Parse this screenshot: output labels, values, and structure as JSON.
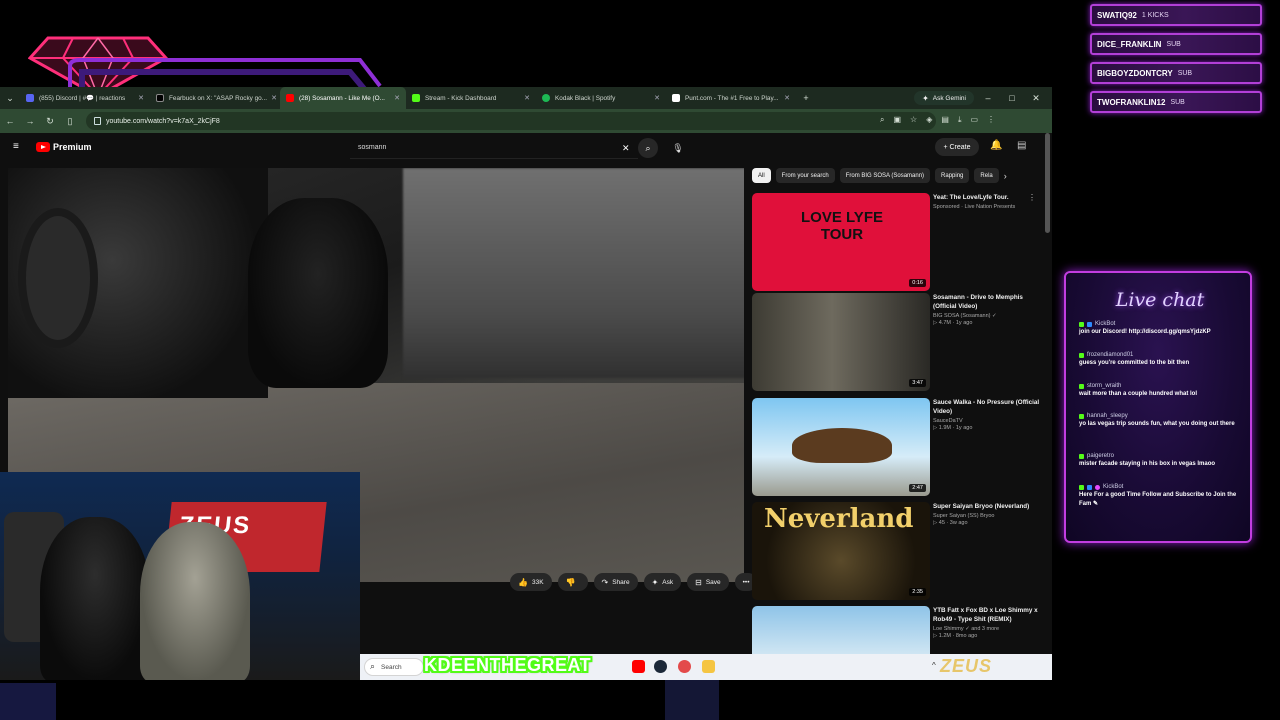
{
  "alerts": [
    {
      "name": "SWATIQ92",
      "tag": "1 KICKS"
    },
    {
      "name": "DICE_FRANKLIN",
      "tag": "SUB"
    },
    {
      "name": "BIGBOYZDONTCRY",
      "tag": "SUB"
    },
    {
      "name": "TWOFRANKLIN12",
      "tag": "SUB"
    }
  ],
  "browser": {
    "tabs": [
      {
        "label": "(855) Discord | #💬 | reactions",
        "color": "#5865f2"
      },
      {
        "label": "Fearbuck on X: \"ASAP Rocky go...",
        "color": "#000000"
      },
      {
        "label": "(28) Sosamann - Like Me (O...",
        "color": "#ff0000"
      },
      {
        "label": "Stream - Kick Dashboard",
        "color": "#53fc18"
      },
      {
        "label": "Kodak Black | Spotify",
        "color": "#1db954"
      },
      {
        "label": "Punt.com - The #1 Free to Play...",
        "color": "#ffffff"
      }
    ],
    "new_tab": "+",
    "gemini": "Ask Gemini",
    "url": "youtube.com/watch?v=k7aX_2kCjF8",
    "nav": {
      "back": "←",
      "forward": "→",
      "reload": "↻",
      "sidebar": "▯"
    },
    "window": {
      "minimize": "–",
      "maximize": "□",
      "close": "✕"
    }
  },
  "youtube": {
    "menu": "≡",
    "logo": "Premium",
    "search_value": "sosmann",
    "clear": "✕",
    "create": "+ Create",
    "actions": [
      {
        "icon": "👍",
        "label": "33K"
      },
      {
        "icon": "👎",
        "label": ""
      },
      {
        "icon": "↷",
        "label": "Share"
      },
      {
        "icon": "✦",
        "label": "Ask"
      },
      {
        "icon": "⊟",
        "label": "Save"
      },
      {
        "icon": "",
        "label": "•••"
      }
    ],
    "chips": [
      {
        "label": "All",
        "active": true
      },
      {
        "label": "From your search",
        "active": false
      },
      {
        "label": "From BIG SOSA (Sosamann)",
        "active": false
      },
      {
        "label": "Rapping",
        "active": false
      },
      {
        "label": "Rela",
        "active": false
      }
    ],
    "recommendations": [
      {
        "title": "Yeat: The Love/Lyfe Tour.",
        "channel": "Sponsored · Live Nation Presents",
        "stats": "",
        "duration": "0:16",
        "thumb_text": "LOVE LYFE TOUR"
      },
      {
        "title": "Sosamann - Drive to Memphis (Official Video)",
        "channel": "BIG SOSA (Sosamann) ✓",
        "stats": "▷ 4.7M · 1y ago",
        "duration": "3:47",
        "thumb_text": ""
      },
      {
        "title": "Sauce Walka - No Pressure (Official Video)",
        "channel": "SauceDaTV",
        "stats": "▷ 1.9M · 1y ago",
        "duration": "2:47",
        "thumb_text": ""
      },
      {
        "title": "Super Saiyan Bryoo (Neverland)",
        "channel": "Super Saiyan (SS) Bryoo",
        "stats": "▷ 45 · 3w ago",
        "duration": "2:35",
        "thumb_text": "Neverland"
      },
      {
        "title": "YTB Fatt x Fox BD x Loe Shimmy x Rob49 - Type Shit (REMIX)",
        "channel": "Loe Shimmy ✓ and 3 more",
        "stats": "▷ 1.2M · 8mo ago",
        "duration": "",
        "thumb_text": ""
      }
    ]
  },
  "taskbar": {
    "search": "Search",
    "streamer": "KDEENTHEGREAT",
    "sponsor": "ZEUS"
  },
  "webcam": {
    "banner": "ZEUS"
  },
  "chat": {
    "title": "Live chat",
    "messages": [
      {
        "user": "KickBot",
        "text": "join our Discord! http://discord.gg/qmsYjdzKP"
      },
      {
        "user": "frozendiamond01",
        "text": "guess you're committed to the bit then"
      },
      {
        "user": "storm_wraith",
        "text": "wait more than a couple hundred what lol"
      },
      {
        "user": "hannah_sleepy",
        "text": "yo las vegas trip sounds fun, what you doing out there"
      },
      {
        "user": "paigeretro",
        "text": "mister facade staying in his box in vegas lmaoo"
      },
      {
        "user": "KickBot",
        "text": "Here For a good Time Follow and Subscribe to Join the Fam ✎"
      }
    ]
  },
  "colors": {
    "accent": "#c23de0",
    "kick_green": "#53fc18",
    "yt_red": "#ff0000"
  }
}
